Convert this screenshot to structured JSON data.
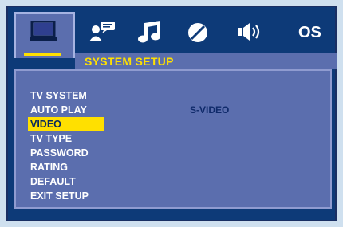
{
  "tabs": [
    {
      "name": "system-tab",
      "icon": "monitor-icon",
      "active": true
    },
    {
      "name": "language-tab",
      "icon": "person-speech-icon",
      "active": false
    },
    {
      "name": "audio-tab",
      "icon": "music-note-icon",
      "active": false
    },
    {
      "name": "video-tab",
      "icon": "disc-icon",
      "active": false
    },
    {
      "name": "speaker-tab",
      "icon": "speaker-icon",
      "active": false
    },
    {
      "name": "os-tab",
      "label": "OS",
      "active": false
    }
  ],
  "header": {
    "title": "SYSTEM SETUP"
  },
  "menu": {
    "items": [
      {
        "label": "TV SYSTEM"
      },
      {
        "label": "AUTO PLAY"
      },
      {
        "label": "VIDEO",
        "selected": true
      },
      {
        "label": "TV TYPE"
      },
      {
        "label": "PASSWORD"
      },
      {
        "label": "RATING"
      },
      {
        "label": "DEFAULT"
      },
      {
        "label": "EXIT SETUP"
      }
    ]
  },
  "selected_value": "S-VIDEO",
  "colors": {
    "background": "#0d3a78",
    "panel": "#5b6eae",
    "highlight": "#ffe000"
  }
}
